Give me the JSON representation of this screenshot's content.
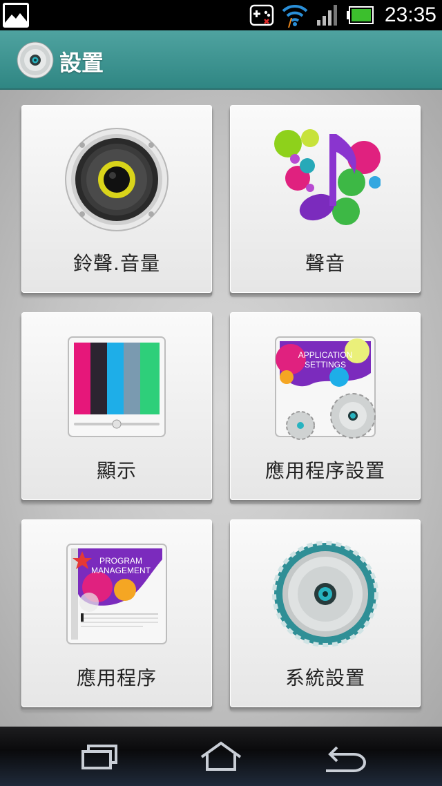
{
  "status_bar": {
    "time": "23:35",
    "icons": [
      "gallery-icon",
      "game-controller-icon",
      "wifi-icon",
      "signal-icon",
      "battery-icon"
    ]
  },
  "title_bar": {
    "title": "設置",
    "icon": "settings-disc-icon"
  },
  "tiles": [
    {
      "label": "鈴聲.音量",
      "icon": "speaker-icon"
    },
    {
      "label": "聲音",
      "icon": "music-note-icon"
    },
    {
      "label": "顯示",
      "icon": "display-bars-icon"
    },
    {
      "label": "應用程序設置",
      "icon": "application-settings-icon",
      "icon_text": [
        "APPLICATION",
        "SETTINGS"
      ]
    },
    {
      "label": "應用程序",
      "icon": "program-management-icon",
      "icon_text": [
        "PROGRAM",
        "MANAGEMENT"
      ]
    },
    {
      "label": "系統設置",
      "icon": "system-gear-icon"
    }
  ],
  "nav_bar": {
    "buttons": [
      "recent-apps-icon",
      "home-icon",
      "back-icon"
    ]
  },
  "colors": {
    "title_bar": "#3c9693",
    "accent_teal": "#2fa3a3",
    "tile_bg": "#f2f2f2"
  }
}
